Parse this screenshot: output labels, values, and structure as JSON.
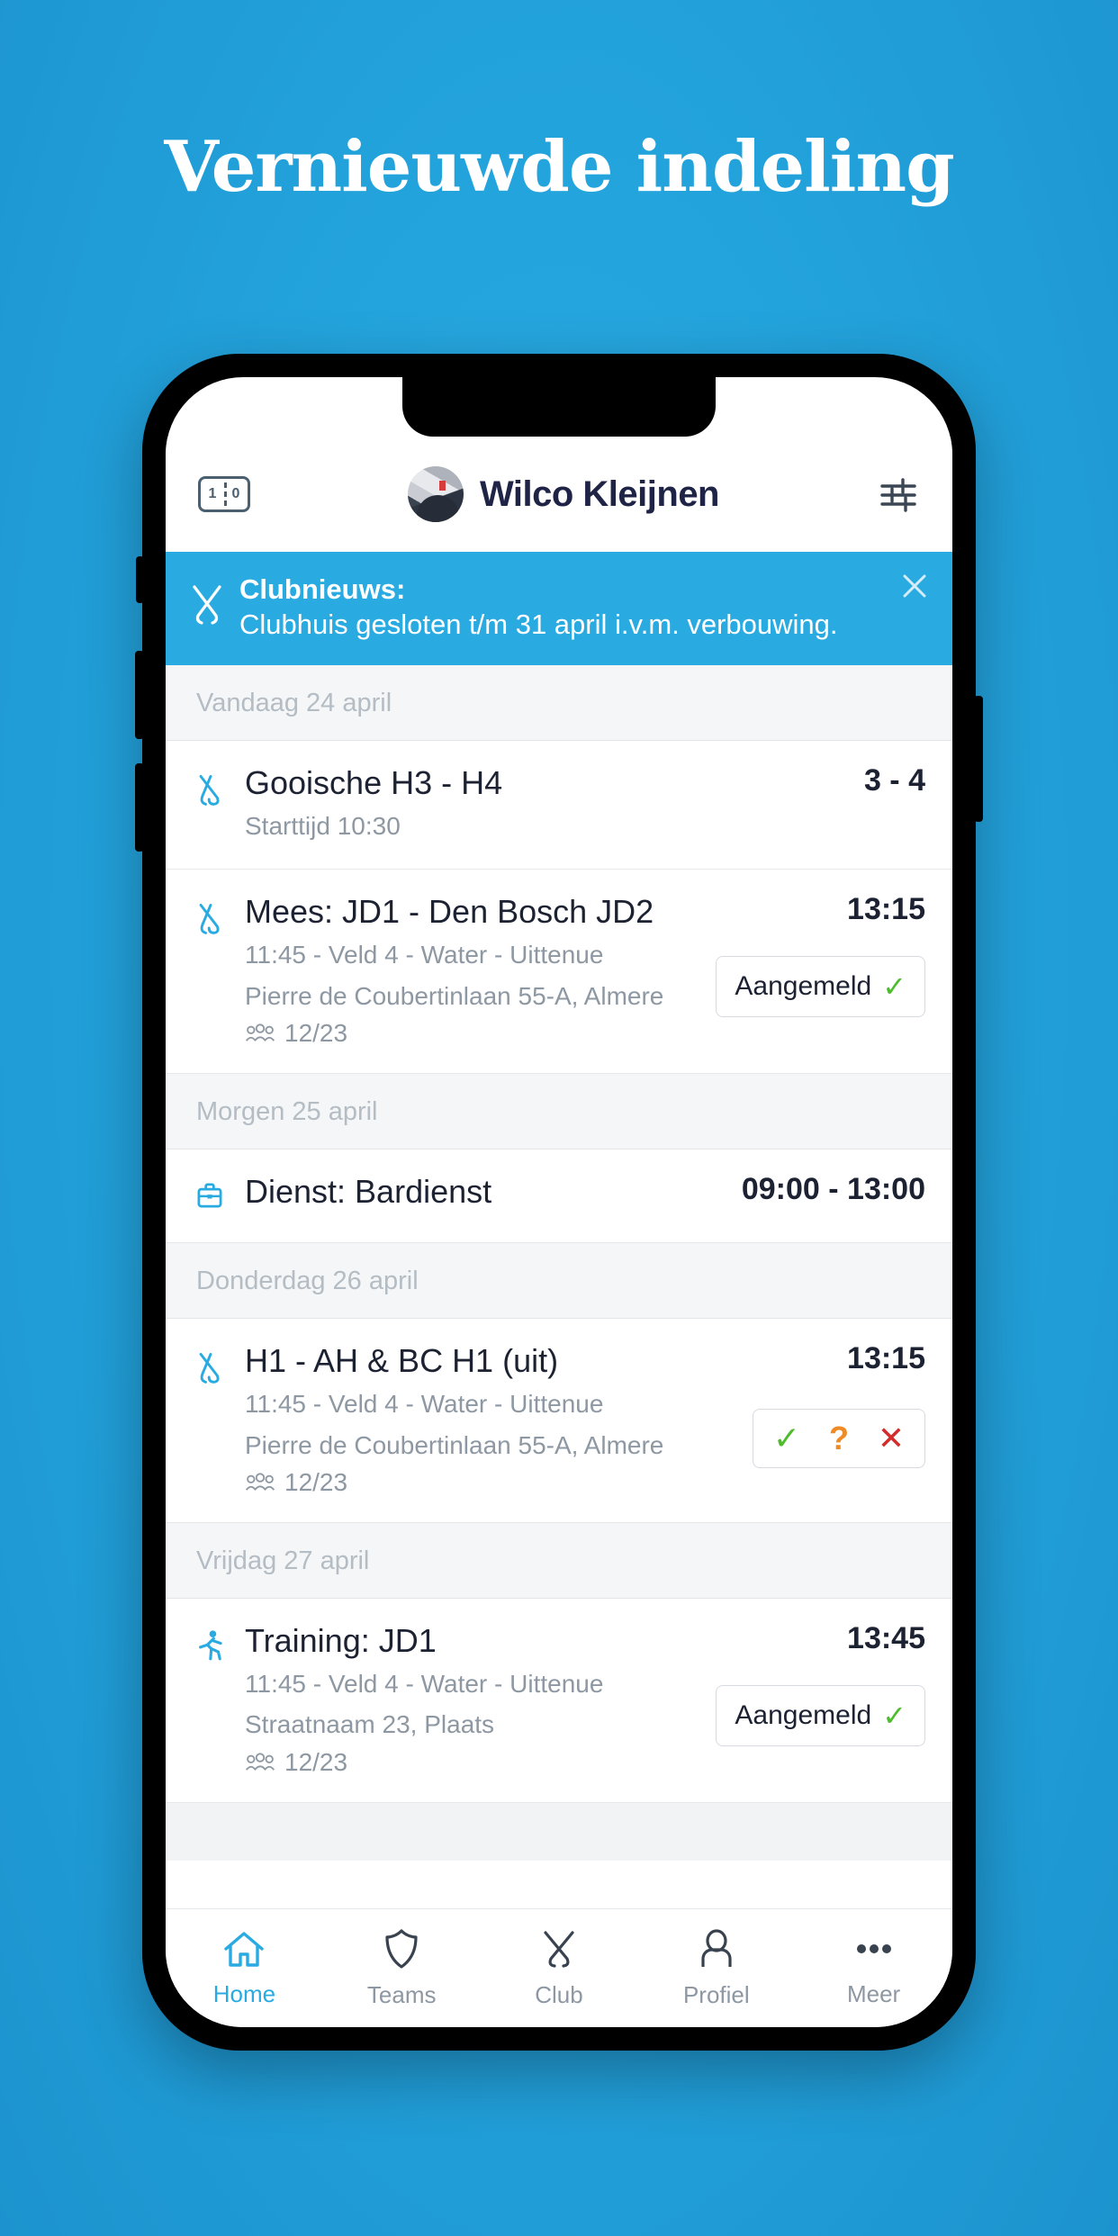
{
  "page": {
    "headline": "Vernieuwde indeling",
    "background_color": "#26A7E0",
    "accent_color": "#29ABE2"
  },
  "header": {
    "score_icon_left": "1",
    "score_icon_right": "0",
    "user_name": "Wilco Kleijnen",
    "score_icon_name": "scoreboard-icon",
    "settings_icon_name": "sliders-icon"
  },
  "banner": {
    "icon": "crossed-hockey-sticks-icon",
    "title": "Clubnieuws:",
    "body": "Clubhuis gesloten t/m 31 april i.v.m. verbouwing.",
    "close_label": "✕",
    "background_color": "#29ABE2"
  },
  "agenda": [
    {
      "day_label": "Vandaag 24 april",
      "events": [
        {
          "icon": "hockey-sticks-icon",
          "title": "Gooische H3 - H4",
          "sub1": "Starttijd 10:30",
          "sub2": "",
          "attendance": "",
          "time": "3 - 4",
          "action_type": "none",
          "action_label": ""
        }
      ]
    },
    {
      "day_label": "",
      "events": [
        {
          "icon": "hockey-sticks-icon",
          "title": "Mees: JD1 - Den Bosch JD2",
          "sub1": "11:45 - Veld 4 - Water - Uittenue",
          "sub2": "Pierre de Coubertinlaan 55-A, Almere",
          "attendance": "12/23",
          "time": "13:15",
          "action_type": "registered",
          "action_label": "Aangemeld"
        }
      ]
    },
    {
      "day_label": "Morgen 25 april",
      "events": [
        {
          "icon": "briefcase-icon",
          "title": "Dienst: Bardienst",
          "sub1": "",
          "sub2": "",
          "attendance": "",
          "time": "09:00 - 13:00",
          "action_type": "none",
          "action_label": ""
        }
      ]
    },
    {
      "day_label": "Donderdag 26 april",
      "events": [
        {
          "icon": "hockey-sticks-icon",
          "title": "H1 - AH & BC H1 (uit)",
          "sub1": "11:45 - Veld 4 - Water - Uittenue",
          "sub2": "Pierre de Coubertinlaan 55-A, Almere",
          "attendance": "12/23",
          "time": "13:15",
          "action_type": "triple",
          "action_label": "",
          "triple": {
            "yes": "✓",
            "maybe": "?",
            "no": "✕"
          }
        }
      ]
    },
    {
      "day_label": "Vrijdag 27 april",
      "events": [
        {
          "icon": "runner-icon",
          "title": "Training: JD1",
          "sub1": "11:45 - Veld 4 - Water - Uittenue",
          "sub2": "Straatnaam 23, Plaats",
          "attendance": "12/23",
          "time": "13:45",
          "action_type": "registered",
          "action_label": "Aangemeld"
        }
      ]
    }
  ],
  "bottom_nav": [
    {
      "label": "Home",
      "icon": "home-icon",
      "active": true
    },
    {
      "label": "Teams",
      "icon": "shield-icon",
      "active": false
    },
    {
      "label": "Club",
      "icon": "crossed-hockey-sticks-icon",
      "active": false
    },
    {
      "label": "Profiel",
      "icon": "person-icon",
      "active": false
    },
    {
      "label": "Meer",
      "icon": "ellipsis-icon",
      "active": false
    }
  ]
}
